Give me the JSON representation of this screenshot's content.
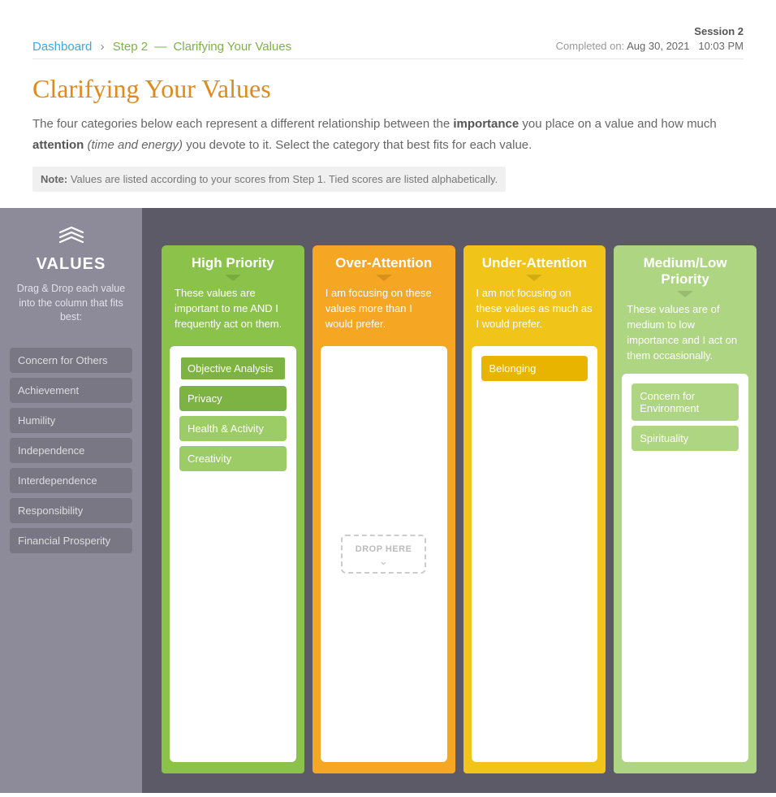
{
  "breadcrumb": {
    "dashboard": "Dashboard",
    "step": "Step 2",
    "title": "Clarifying Your Values"
  },
  "meta": {
    "session_label": "Session 2",
    "completed_label": "Completed on:",
    "completed_date": "Aug 30, 2021",
    "completed_time": "10:03 PM"
  },
  "page": {
    "title": "Clarifying Your Values",
    "intro_pre": "The four categories below each represent a different relationship between the ",
    "intro_strong1": "importance",
    "intro_mid1": " you place on a value and how much ",
    "intro_strong2": "attention",
    "intro_ital": " (time and energy)",
    "intro_post": " you devote to it. Select the category that best fits for each value.",
    "note_label": "Note:",
    "note_text": " Values are listed according to your scores from Step 1. Tied scores are listed alphabetically."
  },
  "sidebar": {
    "heading": "VALUES",
    "instruction": "Drag & Drop each value into the column that fits best:",
    "items": [
      "Concern for Others",
      "Achievement",
      "Humility",
      "Independence",
      "Interdependence",
      "Responsibility",
      "Financial Prosperity"
    ]
  },
  "columns": [
    {
      "title": "High Priority",
      "desc": "These values are important to me AND I frequently act on them.",
      "color": "green",
      "chips": [
        {
          "label": "Objective Analysis",
          "style": "green-chip-selected"
        },
        {
          "label": "Privacy",
          "style": "green-chip-solid"
        },
        {
          "label": "Health & Activity",
          "style": "green-chip-light"
        },
        {
          "label": "Creativity",
          "style": "green-chip-light"
        }
      ]
    },
    {
      "title": "Over-Attention",
      "desc": "I am focusing on these values more than I would prefer.",
      "color": "orange",
      "chips": [],
      "placeholder": "DROP HERE"
    },
    {
      "title": "Under-Attention",
      "desc": "I am not focusing on these values as much as I would prefer.",
      "color": "yellow",
      "chips": [
        {
          "label": "Belonging",
          "style": "yellow-chip"
        }
      ]
    },
    {
      "title": "Medium/Low Priority",
      "desc": "These values are of medium to low importance and I act on them occasionally.",
      "color": "lgreen",
      "chips": [
        {
          "label": "Concern for Environment",
          "style": "lgreen-chip"
        },
        {
          "label": "Spirituality",
          "style": "lgreen-chip"
        }
      ]
    }
  ]
}
